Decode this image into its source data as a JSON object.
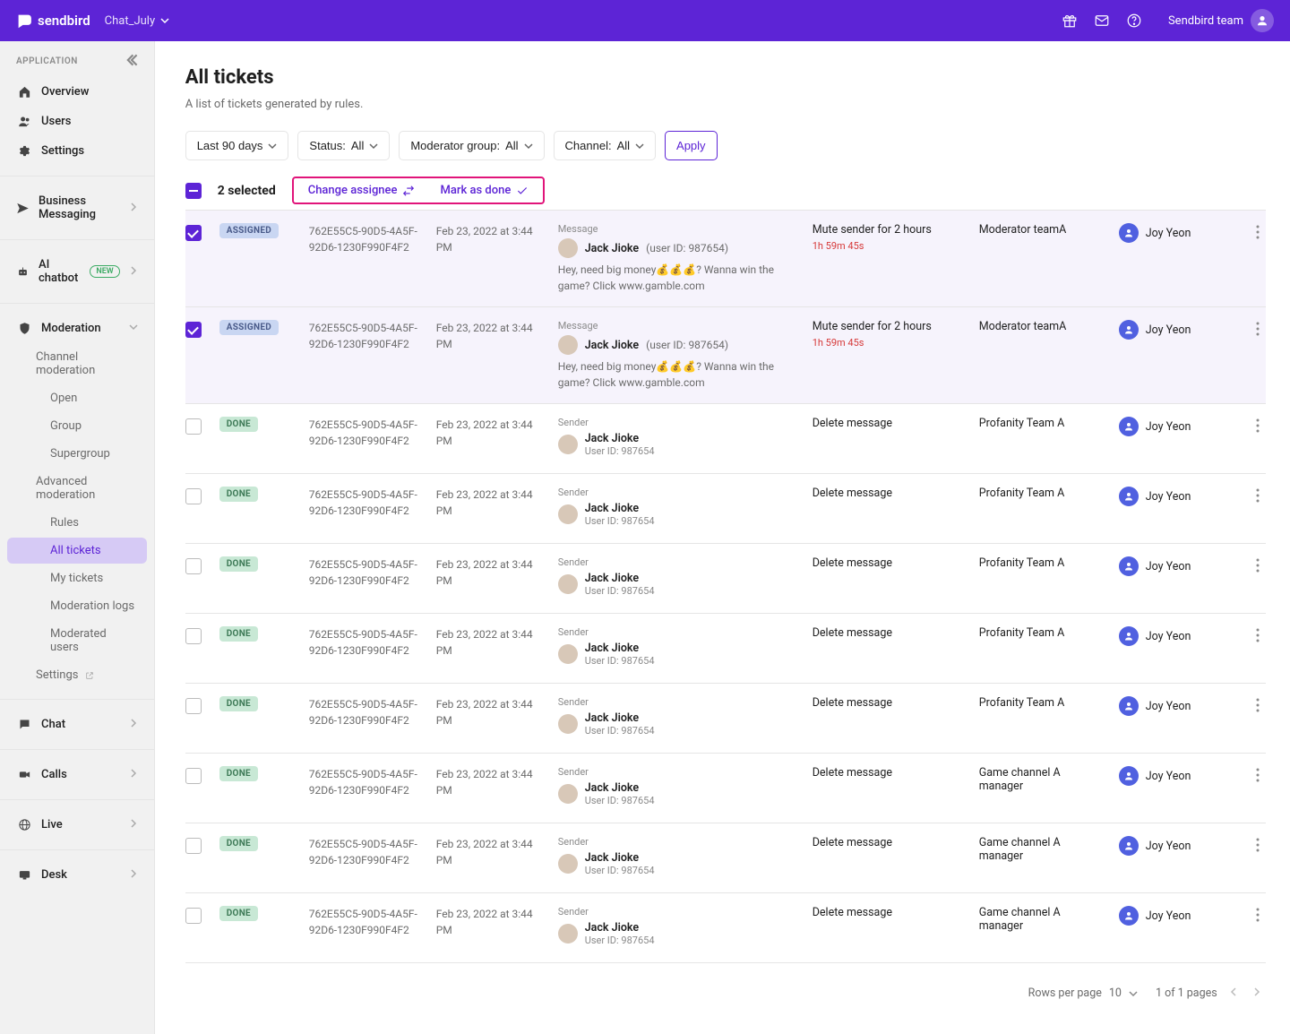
{
  "header": {
    "brand": "sendbird",
    "app_selector": "Chat_July",
    "team_label": "Sendbird team"
  },
  "sidebar": {
    "heading": "APPLICATION",
    "overview": "Overview",
    "users": "Users",
    "settings": "Settings",
    "business_messaging": "Business Messaging",
    "ai_chatbot": "AI chatbot",
    "new_badge": "NEW",
    "moderation": "Moderation",
    "channel_moderation": "Channel moderation",
    "channel_open": "Open",
    "channel_group": "Group",
    "channel_supergroup": "Supergroup",
    "advanced_moderation": "Advanced moderation",
    "rules": "Rules",
    "all_tickets": "All tickets",
    "my_tickets": "My tickets",
    "moderation_logs": "Moderation logs",
    "moderated_users": "Moderated users",
    "mod_settings": "Settings",
    "chat": "Chat",
    "calls": "Calls",
    "live": "Live",
    "desk": "Desk"
  },
  "page": {
    "title": "All tickets",
    "subtitle": "A list of tickets generated by rules."
  },
  "filters": {
    "range": "Last 90 days",
    "status_label": "Status:",
    "status_value": "All",
    "group_label": "Moderator group:",
    "group_value": "All",
    "channel_label": "Channel:",
    "channel_value": "All",
    "apply": "Apply"
  },
  "bulk": {
    "selected_label": "2 selected",
    "change_assignee": "Change assignee",
    "mark_done": "Mark as done"
  },
  "rows": [
    {
      "checked": true,
      "status": "ASSIGNED",
      "status_class": "assigned",
      "selected": true,
      "id": "762E55C5-90D5-4A5F-92D6-1230F990F4F2",
      "date": "Feb 23, 2022 at 3:44 PM",
      "msg_label": "Message",
      "layout": "message",
      "user_name": "Jack Jioke",
      "user_id_inline": "(user ID: 987654)",
      "body": "Hey, need big money💰💰💰? Wanna win the game? Click www.gamble.com",
      "action": "Mute sender for 2 hours",
      "timer": "1h 59m 45s",
      "group": "Moderator teamA",
      "assignee": "Joy Yeon"
    },
    {
      "checked": true,
      "status": "ASSIGNED",
      "status_class": "assigned",
      "selected": true,
      "id": "762E55C5-90D5-4A5F-92D6-1230F990F4F2",
      "date": "Feb 23, 2022 at 3:44 PM",
      "msg_label": "Message",
      "layout": "message",
      "user_name": "Jack Jioke",
      "user_id_inline": "(user ID: 987654)",
      "body": "Hey, need big money💰💰💰? Wanna win the game? Click www.gamble.com",
      "action": "Mute sender for 2 hours",
      "timer": "1h 59m 45s",
      "group": "Moderator teamA",
      "assignee": "Joy Yeon"
    },
    {
      "checked": false,
      "status": "DONE",
      "status_class": "done",
      "selected": false,
      "id": "762E55C5-90D5-4A5F-92D6-1230F990F4F2",
      "date": "Feb 23, 2022 at 3:44 PM",
      "msg_label": "Sender",
      "layout": "sender",
      "user_name": "Jack Jioke",
      "user_id_sub": "User ID: 987654",
      "action": "Delete message",
      "group": "Profanity Team A",
      "assignee": "Joy Yeon"
    },
    {
      "checked": false,
      "status": "DONE",
      "status_class": "done",
      "selected": false,
      "id": "762E55C5-90D5-4A5F-92D6-1230F990F4F2",
      "date": "Feb 23, 2022 at 3:44 PM",
      "msg_label": "Sender",
      "layout": "sender",
      "user_name": "Jack Jioke",
      "user_id_sub": "User ID: 987654",
      "action": "Delete message",
      "group": "Profanity Team A",
      "assignee": "Joy Yeon"
    },
    {
      "checked": false,
      "status": "DONE",
      "status_class": "done",
      "selected": false,
      "id": "762E55C5-90D5-4A5F-92D6-1230F990F4F2",
      "date": "Feb 23, 2022 at 3:44 PM",
      "msg_label": "Sender",
      "layout": "sender",
      "user_name": "Jack Jioke",
      "user_id_sub": "User ID: 987654",
      "action": "Delete message",
      "group": "Profanity Team A",
      "assignee": "Joy Yeon"
    },
    {
      "checked": false,
      "status": "DONE",
      "status_class": "done",
      "selected": false,
      "id": "762E55C5-90D5-4A5F-92D6-1230F990F4F2",
      "date": "Feb 23, 2022 at 3:44 PM",
      "msg_label": "Sender",
      "layout": "sender",
      "user_name": "Jack Jioke",
      "user_id_sub": "User ID: 987654",
      "action": "Delete message",
      "group": "Profanity Team A",
      "assignee": "Joy Yeon"
    },
    {
      "checked": false,
      "status": "DONE",
      "status_class": "done",
      "selected": false,
      "id": "762E55C5-90D5-4A5F-92D6-1230F990F4F2",
      "date": "Feb 23, 2022 at 3:44 PM",
      "msg_label": "Sender",
      "layout": "sender",
      "user_name": "Jack Jioke",
      "user_id_sub": "User ID: 987654",
      "action": "Delete message",
      "group": "Profanity Team A",
      "assignee": "Joy Yeon"
    },
    {
      "checked": false,
      "status": "DONE",
      "status_class": "done",
      "selected": false,
      "id": "762E55C5-90D5-4A5F-92D6-1230F990F4F2",
      "date": "Feb 23, 2022 at 3:44 PM",
      "msg_label": "Sender",
      "layout": "sender",
      "user_name": "Jack Jioke",
      "user_id_sub": "User ID: 987654",
      "action": "Delete message",
      "group": "Game channel A manager",
      "assignee": "Joy Yeon"
    },
    {
      "checked": false,
      "status": "DONE",
      "status_class": "done",
      "selected": false,
      "id": "762E55C5-90D5-4A5F-92D6-1230F990F4F2",
      "date": "Feb 23, 2022 at 3:44 PM",
      "msg_label": "Sender",
      "layout": "sender",
      "user_name": "Jack Jioke",
      "user_id_sub": "User ID: 987654",
      "action": "Delete message",
      "group": "Game channel A manager",
      "assignee": "Joy Yeon"
    },
    {
      "checked": false,
      "status": "DONE",
      "status_class": "done",
      "selected": false,
      "id": "762E55C5-90D5-4A5F-92D6-1230F990F4F2",
      "date": "Feb 23, 2022 at 3:44 PM",
      "msg_label": "Sender",
      "layout": "sender",
      "user_name": "Jack Jioke",
      "user_id_sub": "User ID: 987654",
      "action": "Delete message",
      "group": "Game channel A manager",
      "assignee": "Joy Yeon"
    }
  ],
  "footer": {
    "rpp_label": "Rows per page",
    "rpp_value": "10",
    "page_text": "1 of 1 pages"
  }
}
